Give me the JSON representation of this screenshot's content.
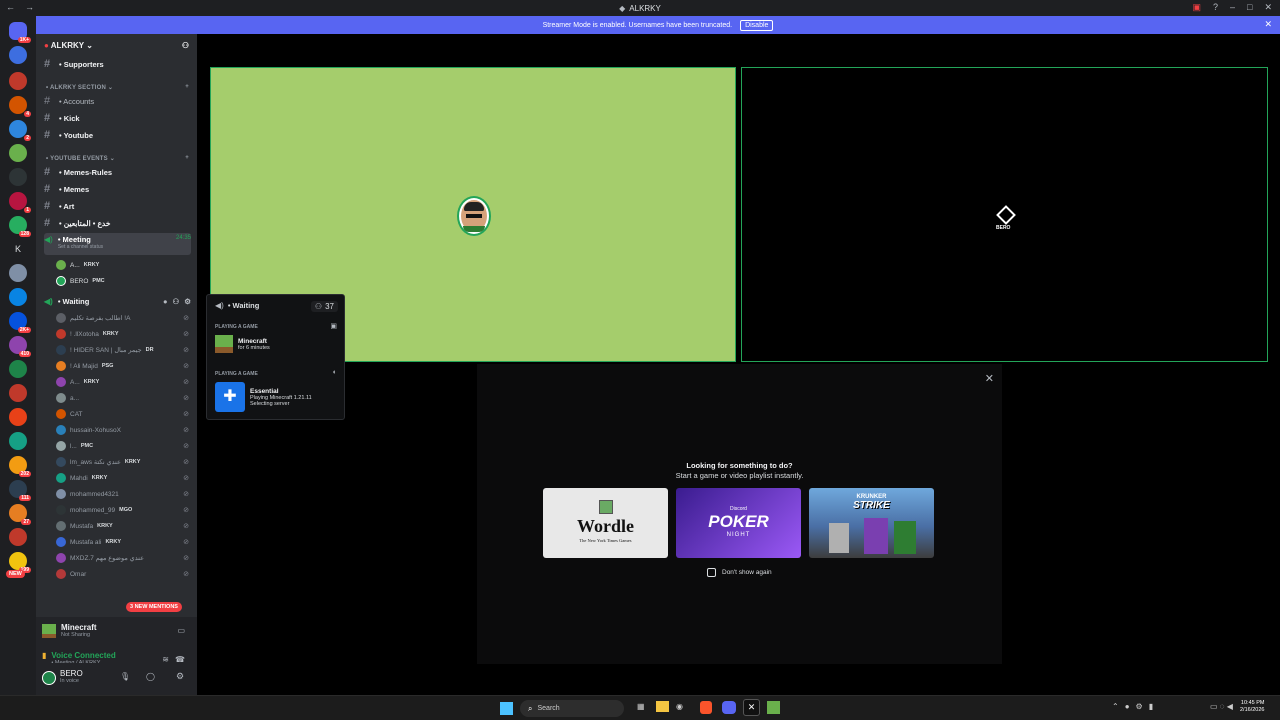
{
  "titlebar": {
    "title": "ALKRKY"
  },
  "banner": {
    "text": "Streamer Mode is enabled. Usernames have been truncated.",
    "disable": "Disable"
  },
  "server_badges": [
    "1K+",
    "4",
    "2",
    "1",
    "128",
    "2K+",
    "410",
    "202",
    "111",
    "27",
    "199"
  ],
  "server_letter": "K",
  "server_new": "NEW",
  "sidebar": {
    "server_name": "ALKRKY",
    "channels_top": [
      {
        "label": "• Supporters"
      }
    ],
    "categories": {
      "alkrky_section": "ALKRKY SECTION",
      "youtube_events": "YOUTUBE EVENTS"
    },
    "channels_mid": [
      {
        "label": "• Accounts"
      },
      {
        "label": "• Kick"
      },
      {
        "label": "• Youtube"
      }
    ],
    "channels_yt": [
      {
        "label": "• Memes-Rules"
      },
      {
        "label": "• Memes"
      },
      {
        "label": "• Art"
      },
      {
        "label": "• خدع • المتابعين"
      }
    ],
    "meeting": {
      "label": "• Meeting",
      "time": "24:35",
      "status": "Set a channel status"
    },
    "meeting_users": [
      {
        "name": "A...",
        "tag": "KRKY"
      },
      {
        "name": "BERO",
        "tag": "PMC"
      }
    ],
    "waiting": {
      "label": "• Waiting"
    },
    "waiting_users": [
      {
        "name": "اطالب بفرصة تكليم !A",
        "tag": ""
      },
      {
        "name": "! .llXotoha",
        "tag": "KRKY"
      },
      {
        "name": "! HIDER SAN | جيمر مبال",
        "tag": "DR"
      },
      {
        "name": "! Ali Majid",
        "tag": "PSG"
      },
      {
        "name": "A...",
        "tag": "KRKY"
      },
      {
        "name": "a...",
        "tag": ""
      },
      {
        "name": "CAT",
        "tag": ""
      },
      {
        "name": "hussain-XohusoX",
        "tag": ""
      },
      {
        "name": "l...",
        "tag": "PMC"
      },
      {
        "name": "lm_aws عندي نكتة",
        "tag": "KRKY"
      },
      {
        "name": "Mahdi",
        "tag": "KRKY"
      },
      {
        "name": "mohammed4321",
        "tag": ""
      },
      {
        "name": "mohammed_99",
        "tag": "MGO"
      },
      {
        "name": "Mustafa",
        "tag": "KRKY"
      },
      {
        "name": "Mustafa ali",
        "tag": "KRKY"
      },
      {
        "name": "MXDZ.7 عندي موضوع مهم",
        "tag": ""
      },
      {
        "name": "Omar",
        "tag": ""
      }
    ],
    "mentions": "3 NEW MENTIONS"
  },
  "activity": {
    "game": "Minecraft",
    "game_status": "Not Sharing",
    "voice": "Voice Connected",
    "voice_loc": "• Meeting / ALKRKY",
    "user": "BERO",
    "user_status": "In voice"
  },
  "tiles": {
    "right_label": "BERO"
  },
  "popup": {
    "channel": "• Waiting",
    "count": "37",
    "section1": "PLAYING A GAME",
    "g1_name": "Minecraft",
    "g1_time": "for 6 minutes",
    "section2": "PLAYING A GAME",
    "g2_name": "Essential",
    "g2_line1": "Playing Minecraft 1.21.11",
    "g2_line2": "Selecting server"
  },
  "activities_panel": {
    "heading": "Looking for something to do?",
    "sub": "Start a game or video playlist instantly.",
    "games": [
      "Wordle",
      "POKER",
      "STRIKE"
    ],
    "wordle_sub": "The New York Times Games",
    "poker_top": "Discord",
    "poker_sub": "NIGHT",
    "krunker_top": "KRUNKER",
    "dont_show": "Don't show again"
  },
  "taskbar": {
    "search": "Search",
    "time": "10:45 PM",
    "date": "2/16/2026"
  }
}
